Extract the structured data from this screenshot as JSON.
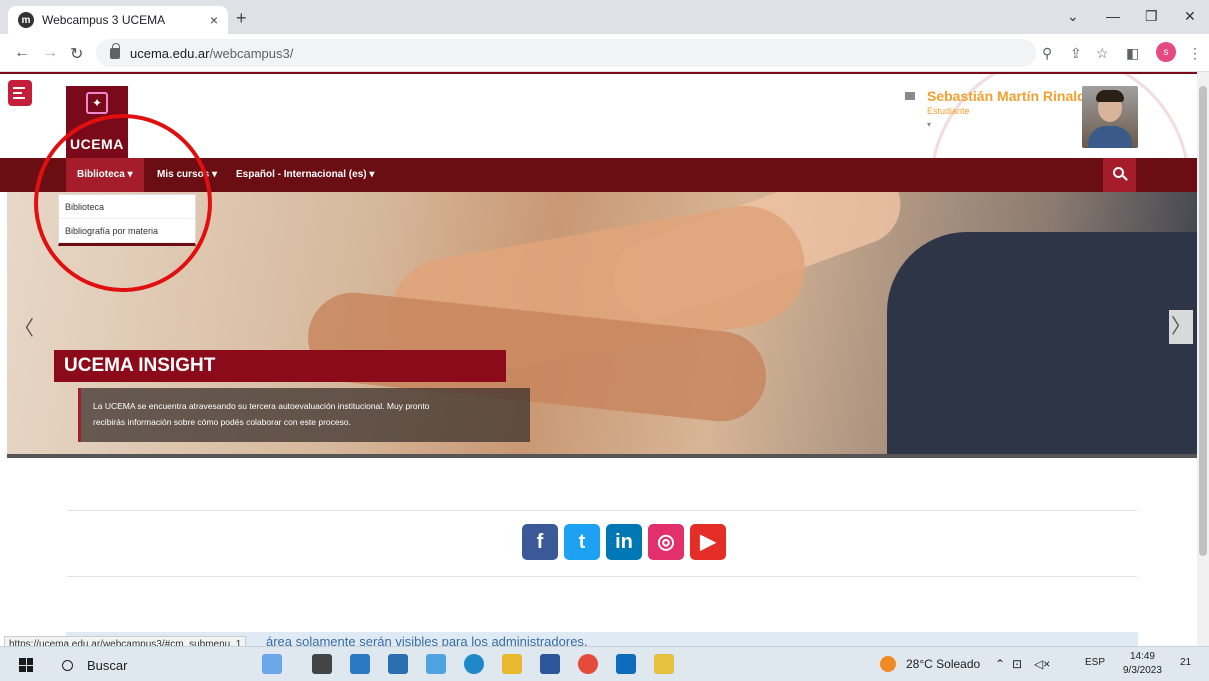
{
  "browser": {
    "tab_title": "Webcampus 3 UCEMA",
    "tab_close": "×",
    "new_tab": "+",
    "url_host": "ucema.edu.ar",
    "url_path": "/webcampus3/",
    "profile_initial": "s"
  },
  "site": {
    "logo_text": "UCEMA",
    "user_name": "Sebastián Martín Rinaldi",
    "user_role": "Estudiante",
    "nav": [
      {
        "label": "Biblioteca ▾"
      },
      {
        "label": "Mis cursos ▾"
      },
      {
        "label": "Español - Internacional (es) ▾"
      }
    ],
    "dropdown": [
      "Biblioteca",
      "Bibliografía por materia"
    ],
    "hero_title": "UCEMA INSIGHT",
    "hero_caption_1": "La UCEMA se encuentra atravesando su tercera autoevaluación institucional. Muy pronto",
    "hero_caption_2": "recibirás información sobre cómo podés colaborar con este proceso.",
    "notice": "área solamente serán visibles para los administradores.",
    "status_url": "https://ucema.edu.ar/webcampus3/#cm_submenu_1"
  },
  "social": [
    {
      "name": "facebook-icon",
      "glyph": "f",
      "color": "#3b5998"
    },
    {
      "name": "twitter-icon",
      "glyph": "t",
      "color": "#1da1f2"
    },
    {
      "name": "linkedin-icon",
      "glyph": "in",
      "color": "#0077b5"
    },
    {
      "name": "instagram-icon",
      "glyph": "◎",
      "color": "#e1306c"
    },
    {
      "name": "youtube-icon",
      "glyph": "▶",
      "color": "#e52d27"
    }
  ],
  "taskbar": {
    "search_label": "Buscar",
    "weather": "28°C Soleado",
    "lang": "ESP",
    "time": "14:49",
    "date": "9/3/2023",
    "notifications": "21"
  }
}
